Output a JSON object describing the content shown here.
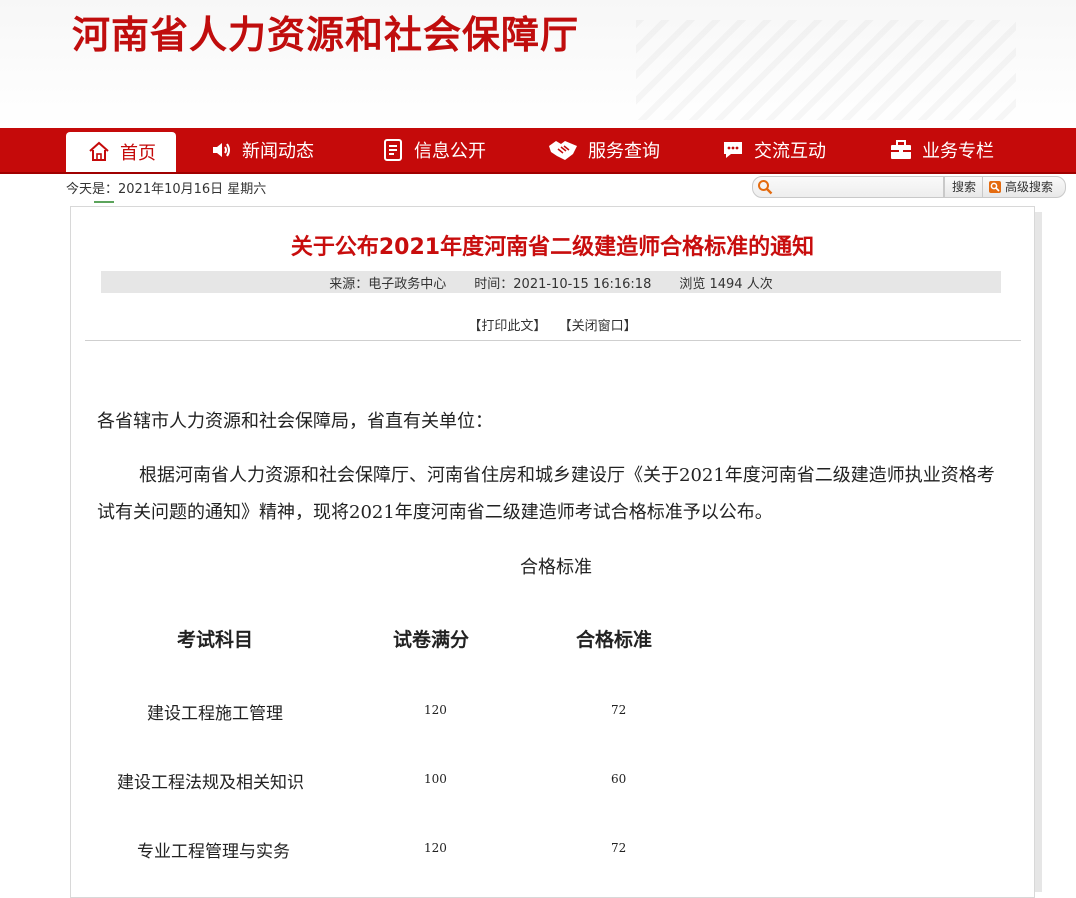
{
  "site": {
    "title": "河南省人力资源和社会保障厅"
  },
  "nav": {
    "items": [
      {
        "label": "首页",
        "icon": "home-icon"
      },
      {
        "label": "新闻动态",
        "icon": "speaker-icon"
      },
      {
        "label": "信息公开",
        "icon": "document-icon"
      },
      {
        "label": "服务查询",
        "icon": "handshake-icon"
      },
      {
        "label": "交流互动",
        "icon": "chat-icon"
      },
      {
        "label": "业务专栏",
        "icon": "briefcase-icon"
      }
    ],
    "active": "首页"
  },
  "datebar": {
    "text": "今天是：2021年10月16日  星期六"
  },
  "search": {
    "placeholder": "",
    "button": "搜索",
    "advanced": "高级搜索"
  },
  "article": {
    "title": "关于公布2021年度河南省二级建造师合格标准的通知",
    "source": "来源：电子政务中心",
    "time": "时间：2021-10-15 16:16:18",
    "views": "浏览 1494 人次",
    "print": "【打印此文】",
    "close": "【关闭窗口】",
    "salutation": "各省辖市人力资源和社会保障局，省直有关单位：",
    "paragraph": "根据河南省人力资源和社会保障厅、河南省住房和城乡建设厅《关于2021年度河南省二级建造师执业资格考试有关问题的通知》精神，现将2021年度河南省二级建造师考试合格标准予以公布。",
    "subtitle": "合格标准",
    "table": {
      "headers": [
        "考试科目",
        "试卷满分",
        "合格标准"
      ],
      "rows": [
        [
          "建设工程施工管理",
          "120",
          "72"
        ],
        [
          "建设工程法规及相关知识",
          "100",
          "60"
        ],
        [
          "专业工程管理与实务",
          "120",
          "72"
        ]
      ]
    }
  },
  "colors": {
    "brand_red": "#c50a0a",
    "title_red": "#c80d0d"
  }
}
